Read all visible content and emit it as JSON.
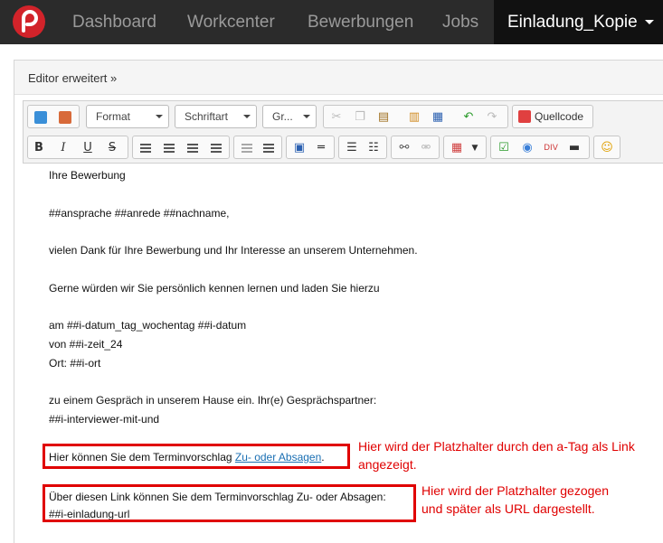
{
  "nav": {
    "items": [
      "Dashboard",
      "Workcenter",
      "Bewerbungen",
      "Jobs"
    ],
    "active": "Einladung_Kopie"
  },
  "panel": {
    "title": "Editor erweitert »"
  },
  "toolbar": {
    "format": "Format",
    "font": "Schriftart",
    "size": "Gr...",
    "source": "Quellcode"
  },
  "content": {
    "line1": "Ihre Bewerbung",
    "line2": "##ansprache ##anrede ##nachname,",
    "line3": "vielen Dank für Ihre Bewerbung und Ihr Interesse an unserem Unternehmen.",
    "line4": "Gerne würden wir Sie persönlich kennen lernen und laden Sie hierzu",
    "line5": "am  ##i-datum_tag_wochentag ##i-datum",
    "line6": "von ##i-zeit_24",
    "line7": "Ort: ##i-ort",
    "line8": "zu einem Gespräch in unserem Hause ein. Ihr(e) Gesprächspartner:",
    "line9": "##i-interviewer-mit-und",
    "box1_text": "Hier können Sie dem Terminvorschlag ",
    "box1_link": "Zu- oder Absagen",
    "box1_end": ".",
    "box2_line1": "Über diesen Link können Sie dem Terminvorschlag Zu- oder Absagen:",
    "box2_line2": "##i-einladung-url"
  },
  "annotations": {
    "a1_line1": "Hier wird der Platzhalter durch den a-Tag als Link",
    "a1_line2": "angezeigt.",
    "a2_line1": "Hier wird der Platzhalter gezogen",
    "a2_line2": "und später als URL dargestellt."
  },
  "colors": {
    "navbar": "#2b2b2b",
    "accent_red": "#e00000",
    "link": "#1a6fb3"
  }
}
